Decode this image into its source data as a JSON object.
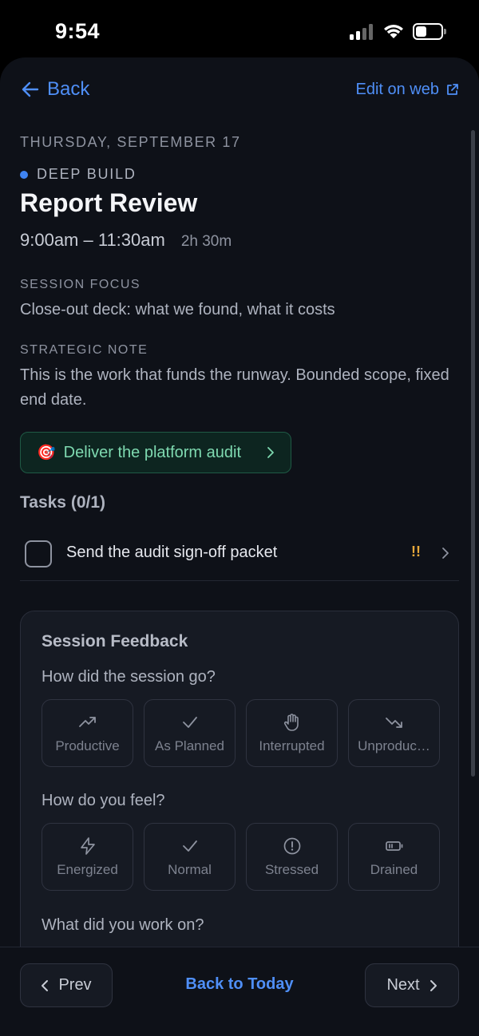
{
  "status": {
    "time": "9:54"
  },
  "header": {
    "back_label": "Back",
    "edit_label": "Edit on web"
  },
  "session": {
    "date": "THURSDAY, SEPTEMBER 17",
    "category": "DEEP BUILD",
    "category_color": "#3f84f2",
    "title": "Report Review",
    "time_range": "9:00am – 11:30am",
    "duration": "2h 30m",
    "focus_label": "SESSION FOCUS",
    "focus_text": "Close-out deck: what we found, what it costs",
    "note_label": "STRATEGIC NOTE",
    "note_text": "This is the work that funds the runway. Bounded scope, fixed end date.",
    "goal": {
      "icon": "dart-target-icon",
      "emoji": "🎯",
      "label": "Deliver the platform audit"
    }
  },
  "tasks": {
    "heading": "Tasks (0/1)",
    "items": [
      {
        "label": "Send the audit sign-off packet",
        "priority": "!!",
        "done": false
      }
    ]
  },
  "feedback": {
    "title": "Session Feedback",
    "q_session": "How did the session go?",
    "session_options": [
      {
        "label": "Productive",
        "icon": "trending-up-icon"
      },
      {
        "label": "As Planned",
        "icon": "check-icon"
      },
      {
        "label": "Interrupted",
        "icon": "hand-icon"
      },
      {
        "label": "Unproduc…",
        "icon": "trending-down-icon"
      }
    ],
    "q_feel": "How do you feel?",
    "feel_options": [
      {
        "label": "Energized",
        "icon": "lightning-icon"
      },
      {
        "label": "Normal",
        "icon": "check-icon"
      },
      {
        "label": "Stressed",
        "icon": "alert-circle-icon"
      },
      {
        "label": "Drained",
        "icon": "battery-low-icon"
      }
    ],
    "q_work": "What did you work on?"
  },
  "footer": {
    "prev_label": "Prev",
    "today_label": "Back to Today",
    "next_label": "Next"
  }
}
